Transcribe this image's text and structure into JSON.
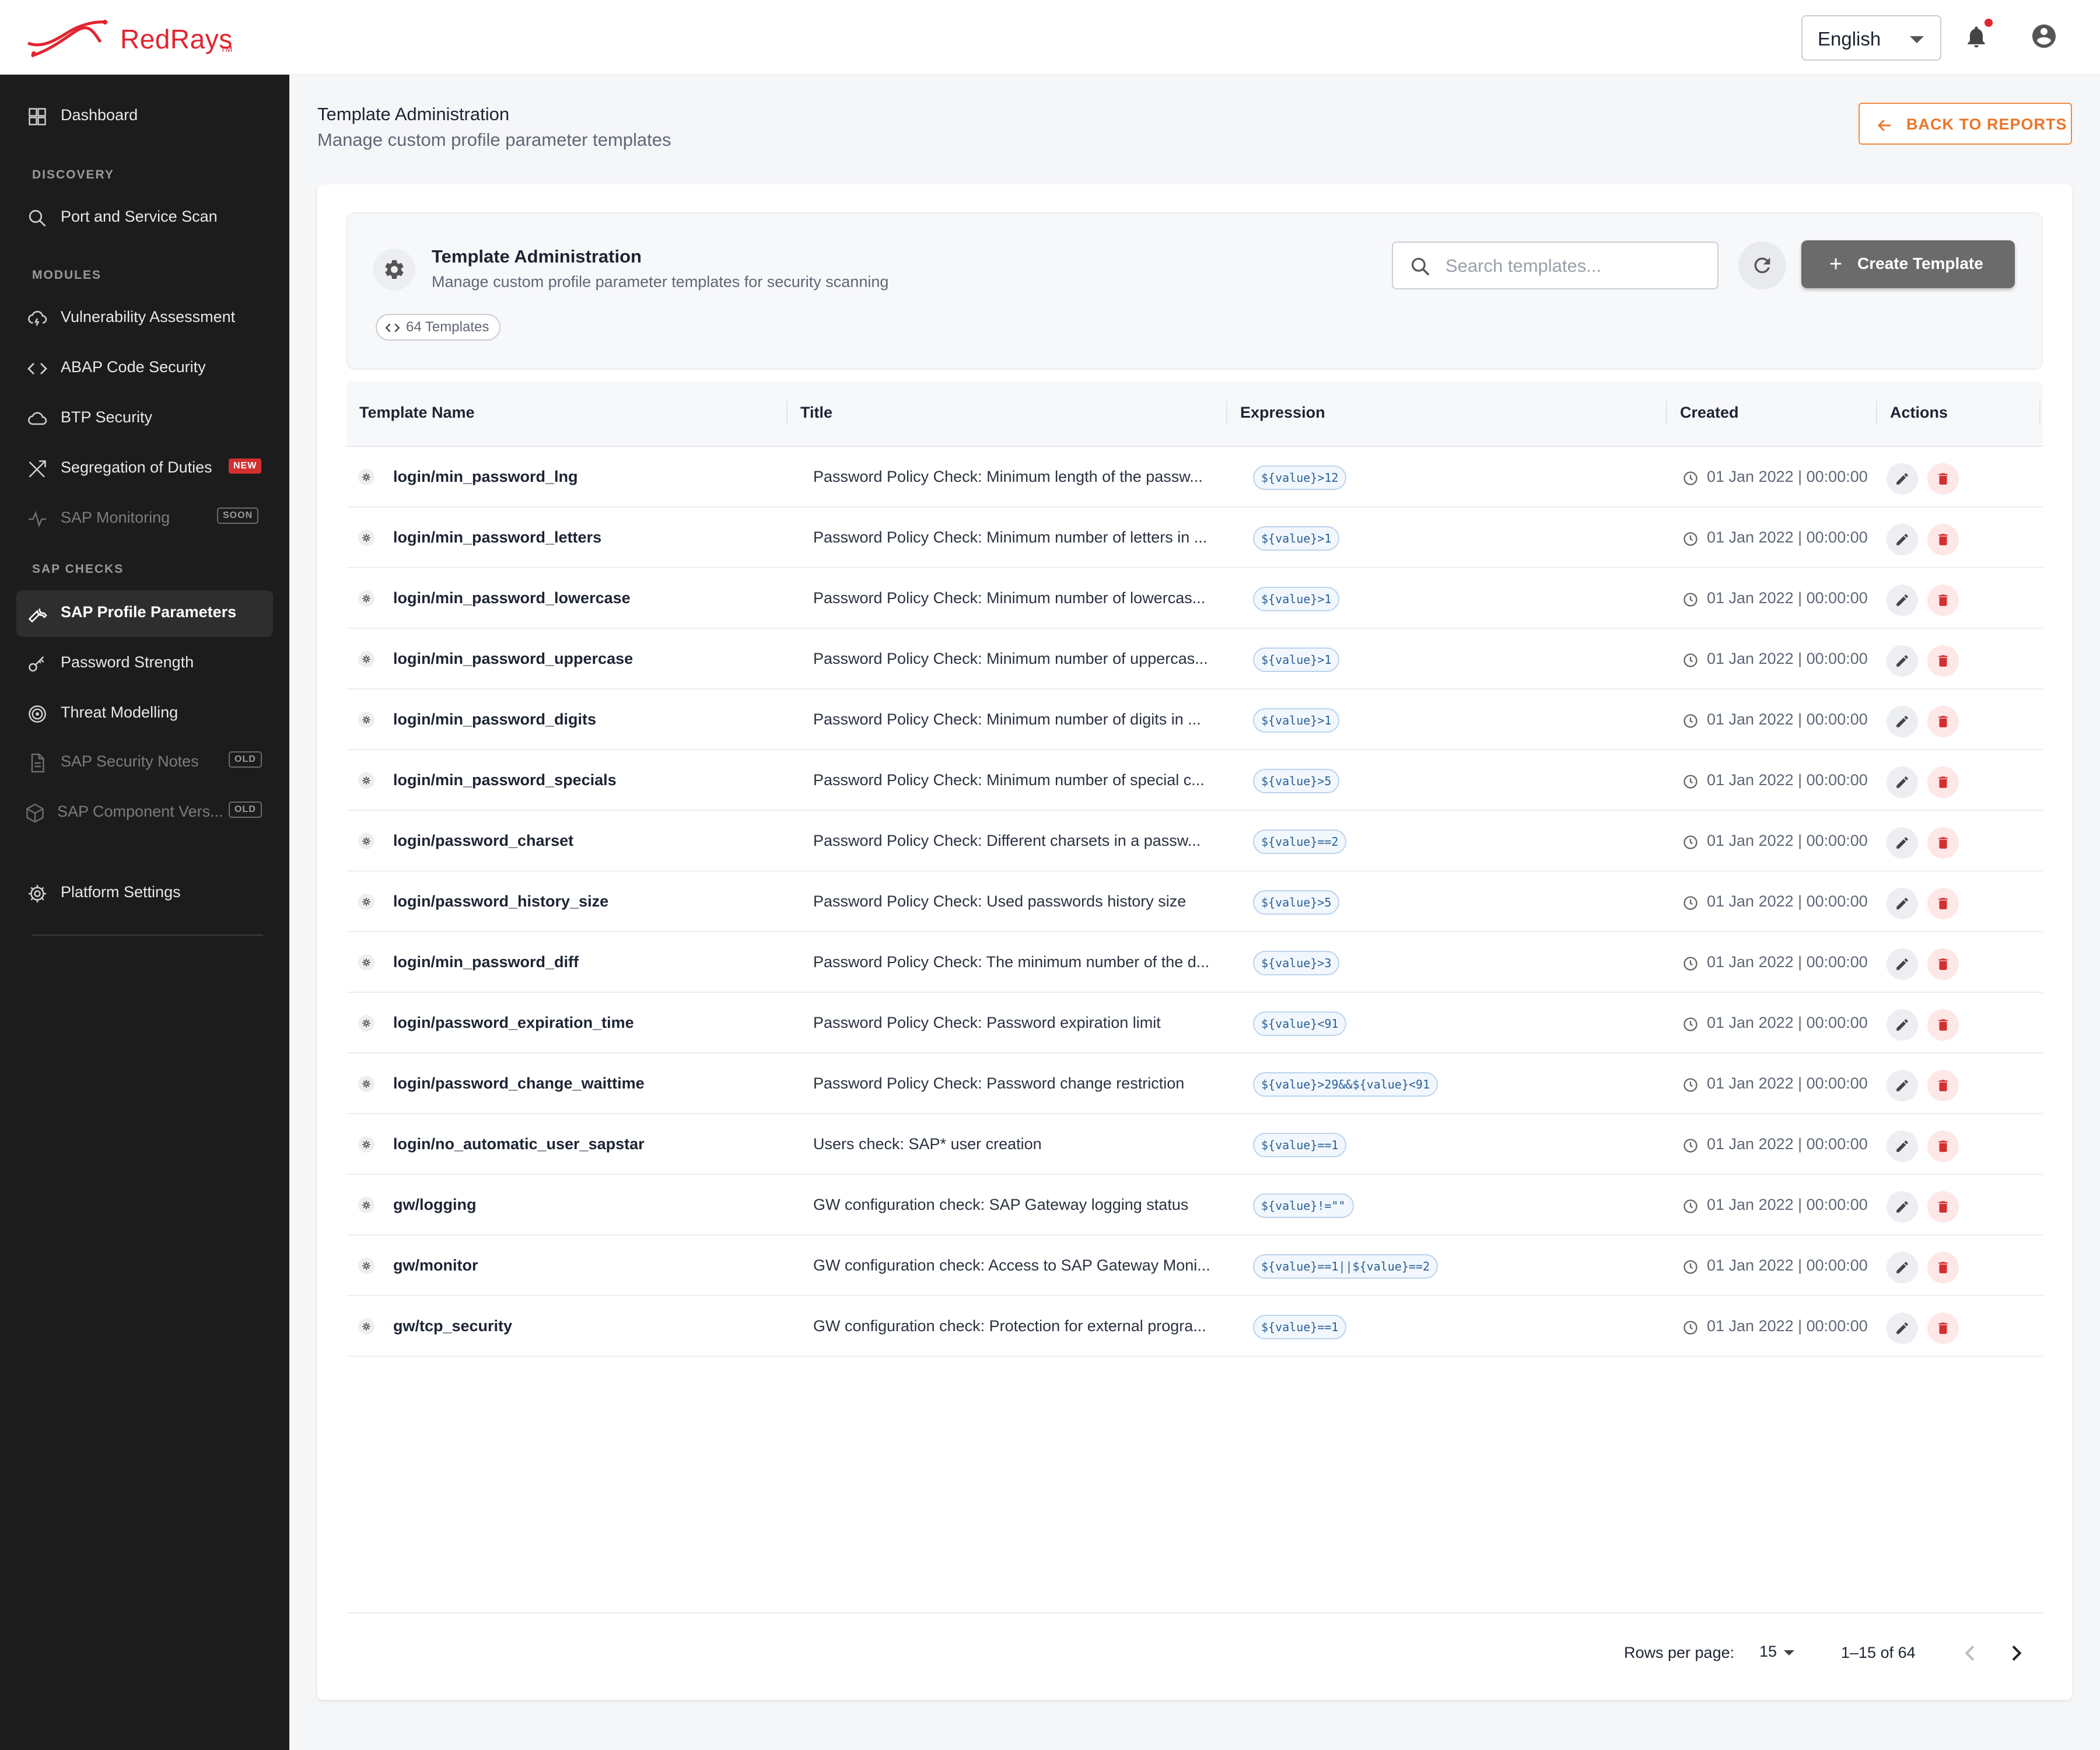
{
  "app": {
    "logo_text": "RedRays",
    "logo_tm": "TM",
    "language": "English",
    "accent_color": "#e2252f",
    "icons": [
      "bell-icon",
      "account-icon"
    ]
  },
  "sidebar": {
    "dashboard": "Dashboard",
    "sections": {
      "discovery": "DISCOVERY",
      "modules": "MODULES",
      "sap_checks": "SAP CHECKS"
    },
    "items": {
      "port_scan": "Port and Service Scan",
      "vuln": "Vulnerability Assessment",
      "abap": "ABAP Code Security",
      "btp": "BTP Security",
      "sod": "Segregation of Duties",
      "sod_badge": "NEW",
      "monitoring": "SAP Monitoring",
      "monitoring_badge": "SOON",
      "profile_params": "SAP Profile Parameters",
      "password_strength": "Password Strength",
      "threat_modelling": "Threat Modelling",
      "security_notes": "SAP Security Notes",
      "security_notes_badge": "OLD",
      "component_versions": "SAP Component Vers...",
      "component_versions_badge": "OLD",
      "platform_settings": "Platform Settings"
    },
    "active_item": "SAP Profile Parameters"
  },
  "page": {
    "title": "Template Administration",
    "subtitle": "Manage custom profile parameter templates",
    "back_button": "BACK TO REPORTS"
  },
  "panel": {
    "title": "Template Administration",
    "subtitle": "Manage custom profile parameter templates for security scanning",
    "count_chip": "64 Templates",
    "search_placeholder": "Search templates...",
    "create_button": "Create Template"
  },
  "table": {
    "columns": [
      "Template Name",
      "Title",
      "Expression",
      "Created",
      "Actions"
    ],
    "rows": [
      {
        "name": "login/min_password_lng",
        "title": "Password Policy Check: Minimum length of the passw...",
        "expression": "${value}>12",
        "created": "01 Jan 2022 | 00:00:00"
      },
      {
        "name": "login/min_password_letters",
        "title": "Password Policy Check: Minimum number of letters in ...",
        "expression": "${value}>1",
        "created": "01 Jan 2022 | 00:00:00"
      },
      {
        "name": "login/min_password_lowercase",
        "title": "Password Policy Check: Minimum number of lowercas...",
        "expression": "${value}>1",
        "created": "01 Jan 2022 | 00:00:00"
      },
      {
        "name": "login/min_password_uppercase",
        "title": "Password Policy Check: Minimum number of uppercas...",
        "expression": "${value}>1",
        "created": "01 Jan 2022 | 00:00:00"
      },
      {
        "name": "login/min_password_digits",
        "title": "Password Policy Check: Minimum number of digits in ...",
        "expression": "${value}>1",
        "created": "01 Jan 2022 | 00:00:00"
      },
      {
        "name": "login/min_password_specials",
        "title": "Password Policy Check: Minimum number of special c...",
        "expression": "${value}>5",
        "created": "01 Jan 2022 | 00:00:00"
      },
      {
        "name": "login/password_charset",
        "title": "Password Policy Check: Different charsets in a passw...",
        "expression": "${value}==2",
        "created": "01 Jan 2022 | 00:00:00"
      },
      {
        "name": "login/password_history_size",
        "title": "Password Policy Check: Used passwords history size",
        "expression": "${value}>5",
        "created": "01 Jan 2022 | 00:00:00"
      },
      {
        "name": "login/min_password_diff",
        "title": "Password Policy Check: The minimum number of the d...",
        "expression": "${value}>3",
        "created": "01 Jan 2022 | 00:00:00"
      },
      {
        "name": "login/password_expiration_time",
        "title": "Password Policy Check: Password expiration limit",
        "expression": "${value}<91",
        "created": "01 Jan 2022 | 00:00:00"
      },
      {
        "name": "login/password_change_waittime",
        "title": "Password Policy Check: Password change restriction",
        "expression": "${value}>29&&${value}<91",
        "created": "01 Jan 2022 | 00:00:00"
      },
      {
        "name": "login/no_automatic_user_sapstar",
        "title": "Users check: SAP* user creation",
        "expression": "${value}==1",
        "created": "01 Jan 2022 | 00:00:00"
      },
      {
        "name": "gw/logging",
        "title": "GW configuration check: SAP Gateway logging status",
        "expression": "${value}!=\"\"",
        "created": "01 Jan 2022 | 00:00:00"
      },
      {
        "name": "gw/monitor",
        "title": "GW configuration check: Access to SAP Gateway Moni...",
        "expression": "${value}==1||${value}==2",
        "created": "01 Jan 2022 | 00:00:00"
      },
      {
        "name": "gw/tcp_security",
        "title": "GW configuration check: Protection for external progra...",
        "expression": "${value}==1",
        "created": "01 Jan 2022 | 00:00:00"
      }
    ]
  },
  "pagination": {
    "rows_per_page_label": "Rows per page:",
    "rows_per_page": "15",
    "range": "1–15 of 64"
  }
}
